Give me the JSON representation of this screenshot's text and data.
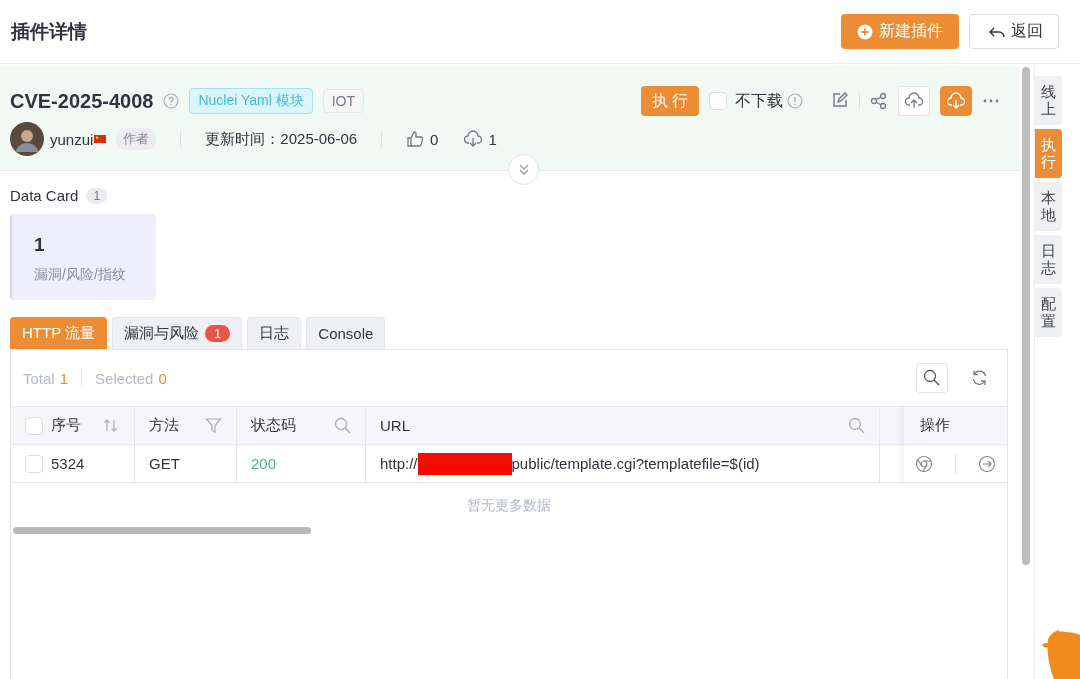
{
  "header": {
    "title": "插件详情",
    "buttons": [
      {
        "label": "新建插件",
        "kind": "primary"
      },
      {
        "label": "返回",
        "kind": "back"
      }
    ]
  },
  "plugin": {
    "name": "CVE-2025-4008",
    "tags": [
      {
        "label": "Nuclei Yaml 模块",
        "kind": "type"
      },
      {
        "label": "IOT",
        "kind": "plain"
      }
    ],
    "author": "yunzui",
    "author_badge": "作者",
    "updated": "更新时间：2025-06-06",
    "likes": "0",
    "downloads": "1",
    "run_button": "执 行",
    "no_download": {
      "label": "不下载",
      "checked": false
    }
  },
  "data_card": {
    "title": "Data Card",
    "count": "1",
    "cards": [
      {
        "value": "1",
        "label": "漏洞/风险/指纹"
      }
    ]
  },
  "tabs": [
    {
      "label": "HTTP 流量",
      "selected": true
    },
    {
      "label": "漏洞与风险",
      "badge": "1",
      "selected": false
    },
    {
      "label": "日志",
      "selected": false
    },
    {
      "label": "Console",
      "selected": false
    }
  ],
  "table": {
    "all_checked": false,
    "total_label": "Total",
    "total": "1",
    "selected_label": "Selected",
    "selected": "0",
    "columns": [
      {
        "label": "序号",
        "kind": "sort"
      },
      {
        "label": "方法",
        "kind": "filter"
      },
      {
        "label": "状态码",
        "kind": "search"
      },
      {
        "label": "URL",
        "kind": "search"
      },
      {
        "label": "操作",
        "kind": "actions"
      }
    ],
    "rows": [
      {
        "checked": false,
        "id": "5324",
        "method": "GET",
        "status": "200",
        "url_prefix": "http://",
        "url_suffix": "public/template.cgi?templatefile=$(id)"
      }
    ],
    "empty_text": "暂无更多数据"
  },
  "side_tabs": [
    {
      "label": "线上",
      "selected": false
    },
    {
      "label": "执行",
      "selected": true
    },
    {
      "label": "本地",
      "selected": false
    },
    {
      "label": "日志",
      "selected": false
    },
    {
      "label": "配置",
      "selected": false
    }
  ]
}
